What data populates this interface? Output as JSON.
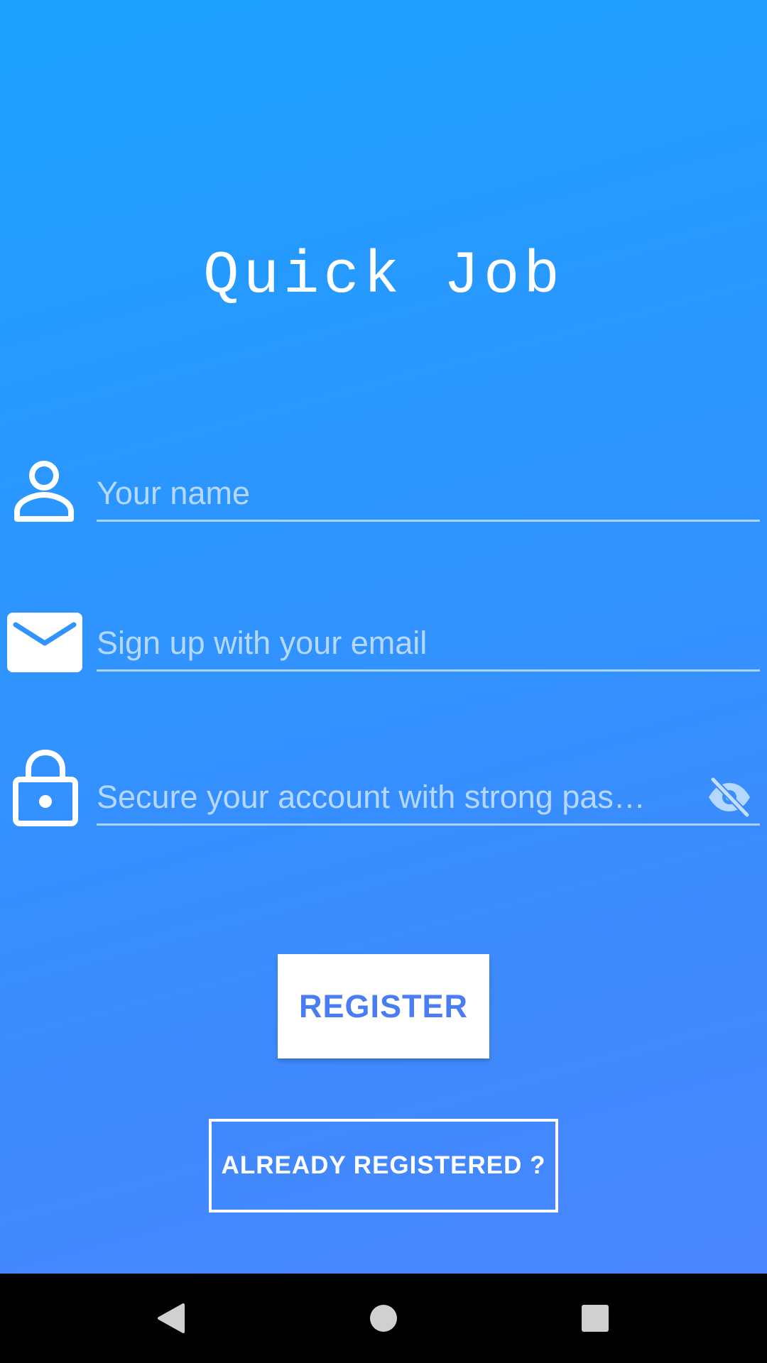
{
  "app": {
    "title": "Quick Job"
  },
  "form": {
    "name_field": {
      "placeholder": "Your name",
      "value": "",
      "icon": "person-icon"
    },
    "email_field": {
      "placeholder": "Sign up with your email",
      "value": "",
      "icon": "mail-icon"
    },
    "password_field": {
      "placeholder": "Secure your account with strong pas…",
      "value": "",
      "icon": "lock-icon",
      "toggle_icon": "visibility-off-icon"
    }
  },
  "actions": {
    "register_label": "REGISTER",
    "already_registered_label": "ALREADY REGISTERED ?"
  },
  "navigation": {
    "back_icon": "back-triangle-icon",
    "home_icon": "home-circle-icon",
    "recents_icon": "recents-square-icon"
  },
  "colors": {
    "gradient_top": "#1ba1fe",
    "gradient_bottom": "#4a86fe",
    "register_text": "#4a7df2",
    "nav_bar": "#000000"
  }
}
